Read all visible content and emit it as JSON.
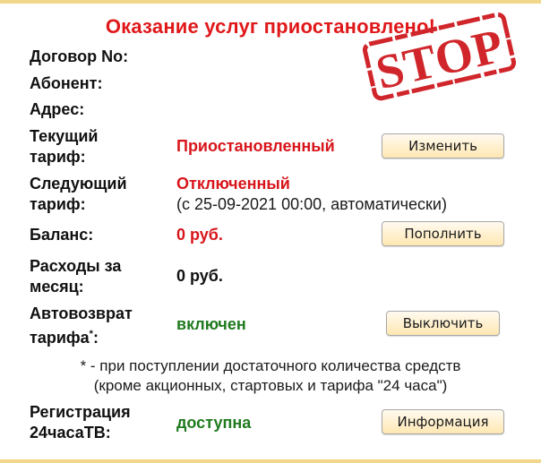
{
  "banner": "Оказание услуг приостановлено!",
  "stamp": "STOP",
  "rows": {
    "contract_label": "Договор No:",
    "subscriber_label": "Абонент:",
    "address_label": "Адрес:",
    "current_tariff_label_1": "Текущий",
    "current_tariff_label_2": "тариф:",
    "current_tariff_value": "Приостановленный",
    "change_button": "Изменить",
    "next_tariff_label_1": "Следующий",
    "next_tariff_label_2": "тариф:",
    "next_tariff_value": "Отключенный",
    "next_tariff_note": "(с 25-09-2021 00:00, автоматически)",
    "balance_label": "Баланс:",
    "balance_value": "0 руб.",
    "topup_button": "Пополнить",
    "expenses_label_1": "Расходы за",
    "expenses_label_2": "месяц:",
    "expenses_value": "0 руб.",
    "autoreturn_label_1": "Автовозврат",
    "autoreturn_label_2": "тарифа",
    "autoreturn_sup": "*",
    "autoreturn_colon": ":",
    "autoreturn_value": "включен",
    "disable_button": "Выключить",
    "footnote_1": "* - при поступлении достаточного количества средств",
    "footnote_2": "(кроме акционных, стартовых и тарифа \"24 часа\")",
    "registration_label_1": "Регистрация",
    "registration_label_2": "24часаТВ:",
    "registration_value": "доступна",
    "info_button": "Информация"
  },
  "colors": {
    "alert_red": "#e0181a",
    "status_red": "#d8151b",
    "status_green": "#1f7a1f",
    "button_bg": "#ffefc8",
    "stamp_red": "#d0262b",
    "border": "#f0d78a"
  }
}
